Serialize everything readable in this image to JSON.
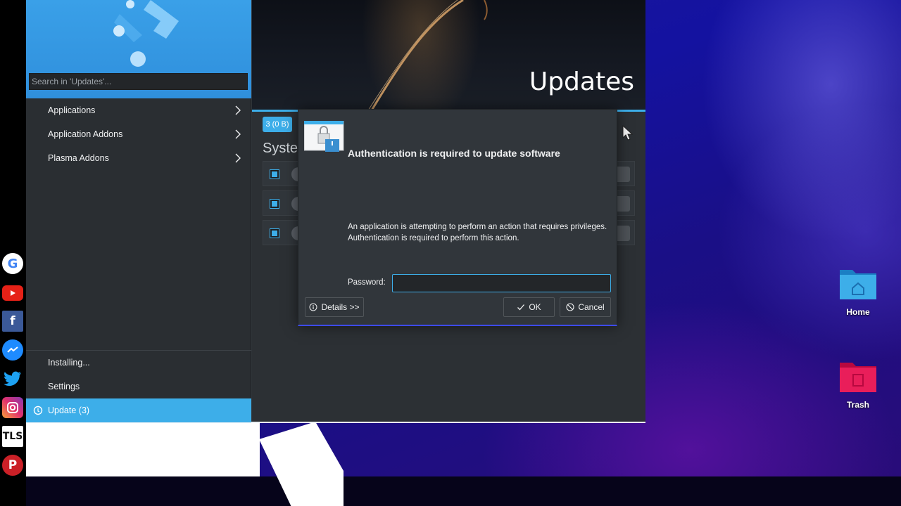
{
  "app": {
    "search_placeholder": "Search in 'Updates'...",
    "nav": [
      {
        "label": "Applications"
      },
      {
        "label": "Application Addons"
      },
      {
        "label": "Plasma Addons"
      }
    ],
    "bottom_nav": [
      {
        "label": "Installing..."
      },
      {
        "label": "Settings"
      }
    ],
    "update_item": {
      "label": "Update (3)"
    },
    "page_title": "Updates",
    "size_badge": "3 (0 B)",
    "section_label": "Syster",
    "update_row_count": 3
  },
  "dialog": {
    "title": "Authentication is required to update software",
    "message": "An application is attempting to perform an action that requires privileges. Authentication is required to perform this action.",
    "password_label": "Password:",
    "password_value": "",
    "details_label": "Details >>",
    "ok_label": "OK",
    "cancel_label": "Cancel"
  },
  "desktop": {
    "icons": [
      {
        "label": "Home"
      },
      {
        "label": "Trash"
      }
    ]
  },
  "social_icons": [
    "google-icon",
    "youtube-icon",
    "facebook-icon",
    "messenger-icon",
    "twitter-icon",
    "instagram-icon",
    "tls-icon",
    "pinterest-icon"
  ],
  "colors": {
    "accent": "#3daee9",
    "window_bg": "#31363b",
    "dialog_border": "#3d4aeb"
  }
}
